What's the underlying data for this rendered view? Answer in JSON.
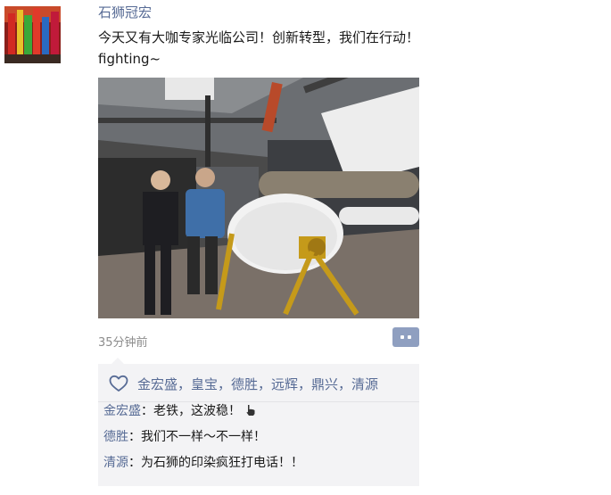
{
  "post": {
    "author": "石狮冠宏",
    "text": "今天又有大咖专家光临公司！创新转型，我们在行动！\nfighting~",
    "timestamp": "35分钟前"
  },
  "likes": {
    "names": "金宏盛，皇宝，德胜，远辉，鼎兴，清源"
  },
  "comments": [
    {
      "author": "金宏盛",
      "separator": "：",
      "text": "老铁，这波稳！",
      "emoji": "hand-pointing-icon"
    },
    {
      "author": "德胜",
      "separator": "：",
      "text": "我们不一样～不一样！"
    },
    {
      "author": "清源",
      "separator": "：",
      "text": "为石狮的印染疯狂打电话！！"
    }
  ],
  "colors": {
    "link": "#576b95",
    "feedback_bg": "#f3f3f5",
    "comment_button": "#8f9fc0",
    "timestamp": "#8c8c8c"
  },
  "icons": {
    "like": "heart-outline-icon",
    "comment": "comment-dots-icon"
  }
}
